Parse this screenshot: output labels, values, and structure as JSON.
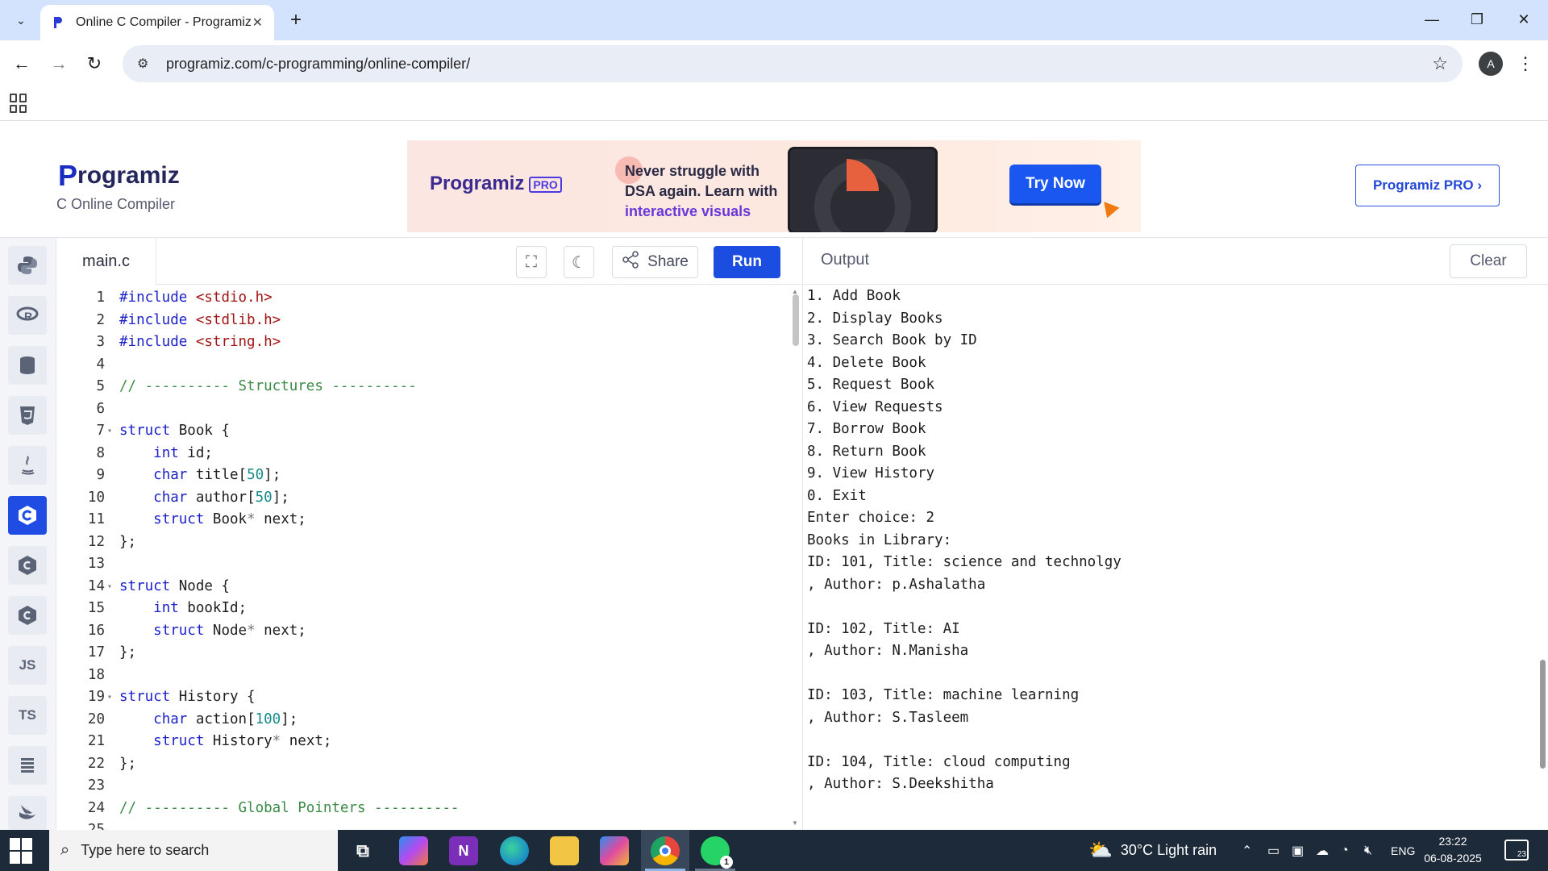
{
  "browser": {
    "tab_title": "Online C Compiler - Programiz",
    "tab_close": "✕",
    "new_tab": "+",
    "url": "programiz.com/c-programming/online-compiler/",
    "avatar_letter": "A"
  },
  "site": {
    "logo_p": "P",
    "logo_rest": "rogramiz",
    "subtitle": "C Online Compiler",
    "ad": {
      "brand": "Programiz",
      "pro_badge": "PRO",
      "line1": "Never struggle with",
      "line2": "DSA again. Learn with",
      "line3": "interactive visuals",
      "cta": "Try Now"
    },
    "pro_button": "Programiz PRO ›"
  },
  "rail": {
    "items": [
      "python-icon",
      "r-icon",
      "sql-icon",
      "html-icon",
      "java-icon",
      "c-icon",
      "cpp-icon",
      "csharp-icon",
      "JS",
      "TS",
      "go-icon",
      "swift-icon"
    ],
    "active": "c-icon"
  },
  "editor": {
    "filename": "main.c",
    "share_label": "Share",
    "run_label": "Run",
    "lines": [
      {
        "n": "1",
        "html": "<span class='kw'>#include</span> <span class='inc'>&lt;stdio.h&gt;</span>"
      },
      {
        "n": "2",
        "html": "<span class='kw'>#include</span> <span class='inc'>&lt;stdlib.h&gt;</span>"
      },
      {
        "n": "3",
        "html": "<span class='kw'>#include</span> <span class='inc'>&lt;string.h&gt;</span>"
      },
      {
        "n": "4",
        "html": ""
      },
      {
        "n": "5",
        "html": "<span class='cmt'>// ---------- Structures ----------</span>"
      },
      {
        "n": "6",
        "html": ""
      },
      {
        "n": "7",
        "fold": true,
        "html": "<span class='kw'>struct</span> Book {"
      },
      {
        "n": "8",
        "html": "    <span class='kw'>int</span> id;"
      },
      {
        "n": "9",
        "html": "    <span class='kw'>char</span> title[<span class='num'>50</span>];"
      },
      {
        "n": "10",
        "html": "    <span class='kw'>char</span> author[<span class='num'>50</span>];"
      },
      {
        "n": "11",
        "html": "    <span class='kw'>struct</span> Book<span class='ptr'>*</span> next;"
      },
      {
        "n": "12",
        "html": "};"
      },
      {
        "n": "13",
        "html": ""
      },
      {
        "n": "14",
        "fold": true,
        "html": "<span class='kw'>struct</span> Node {"
      },
      {
        "n": "15",
        "html": "    <span class='kw'>int</span> bookId;"
      },
      {
        "n": "16",
        "html": "    <span class='kw'>struct</span> Node<span class='ptr'>*</span> next;"
      },
      {
        "n": "17",
        "html": "};"
      },
      {
        "n": "18",
        "html": ""
      },
      {
        "n": "19",
        "fold": true,
        "html": "<span class='kw'>struct</span> History {"
      },
      {
        "n": "20",
        "html": "    <span class='kw'>char</span> action[<span class='num'>100</span>];"
      },
      {
        "n": "21",
        "html": "    <span class='kw'>struct</span> History<span class='ptr'>*</span> next;"
      },
      {
        "n": "22",
        "html": "};"
      },
      {
        "n": "23",
        "html": ""
      },
      {
        "n": "24",
        "html": "<span class='cmt'>// ---------- Global Pointers ----------</span>"
      },
      {
        "n": "25",
        "html": ""
      }
    ]
  },
  "output": {
    "label": "Output",
    "clear_label": "Clear",
    "lines": [
      "1. Add Book",
      "2. Display Books",
      "3. Search Book by ID",
      "4. Delete Book",
      "5. Request Book",
      "6. View Requests",
      "7. Borrow Book",
      "8. Return Book",
      "9. View History",
      "0. Exit",
      "Enter choice: 2",
      "Books in Library:",
      "ID: 101, Title: science and technolgy",
      ", Author: p.Ashalatha",
      "",
      "ID: 102, Title: AI",
      ", Author: N.Manisha",
      "",
      "ID: 103, Title: machine learning",
      ", Author: S.Tasleem",
      "",
      "ID: 104, Title: cloud computing",
      ", Author: S.Deekshitha"
    ]
  },
  "taskbar": {
    "search_placeholder": "Type here to search",
    "weather": "30°C  Light rain",
    "lang": "ENG",
    "time": "23:22",
    "date": "06-08-2025",
    "notif_count": "23",
    "whatsapp_badge": "1"
  },
  "colors": {
    "accent": "#1a4de0",
    "tabstrip": "#d3e3fd",
    "taskbar": "#1c2a3a"
  }
}
